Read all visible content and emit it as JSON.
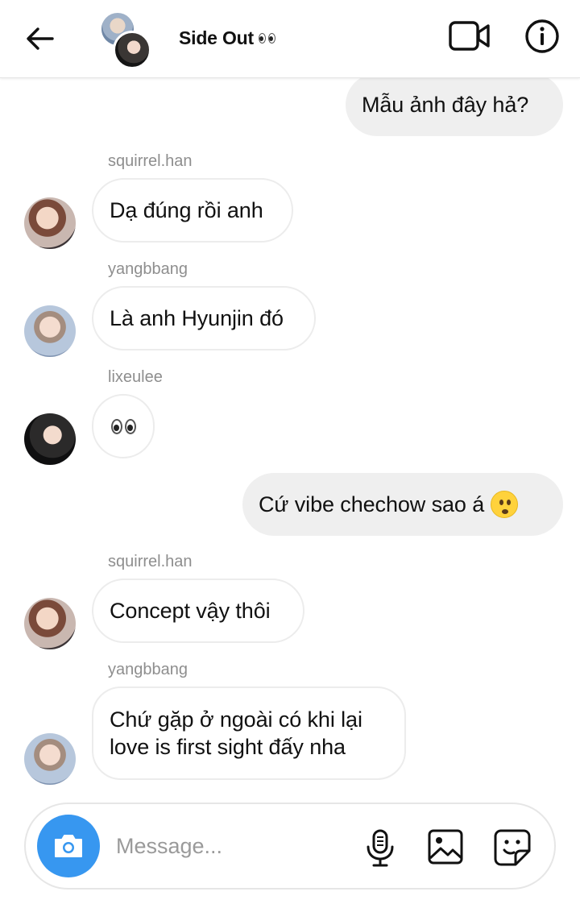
{
  "header": {
    "title": "Side Out",
    "title_emoji": "eyes-emoji"
  },
  "messages": [
    {
      "type": "out",
      "text": "Mẫu ảnh đây hả?"
    },
    {
      "type": "in",
      "sender": "squirrel.han",
      "text": "Dạ đúng rồi anh"
    },
    {
      "type": "in",
      "sender": "yangbbang",
      "text": "Là anh Hyunjin đó"
    },
    {
      "type": "in",
      "sender": "lixeulee",
      "text": "",
      "emoji": "eyes-emoji"
    },
    {
      "type": "out",
      "text": "Cứ vibe chechow sao á",
      "emoji": "face-with-open-mouth-emoji"
    },
    {
      "type": "in",
      "sender": "squirrel.han",
      "text": "Concept vậy thôi"
    },
    {
      "type": "in",
      "sender": "yangbbang",
      "text_line1": "Chứ gặp ở ngoài có khi lại",
      "text_line2": "love is first sight đấy nha"
    }
  ],
  "composer": {
    "placeholder": "Message..."
  },
  "icons": [
    "back-arrow-icon",
    "video-call-icon",
    "info-icon",
    "camera-icon",
    "microphone-icon",
    "gallery-icon",
    "sticker-icon"
  ],
  "colors": {
    "accent": "#3797f0",
    "outgoing_bubble": "#efefef",
    "incoming_border": "#ececec",
    "sender_text": "#8e8e8e"
  }
}
